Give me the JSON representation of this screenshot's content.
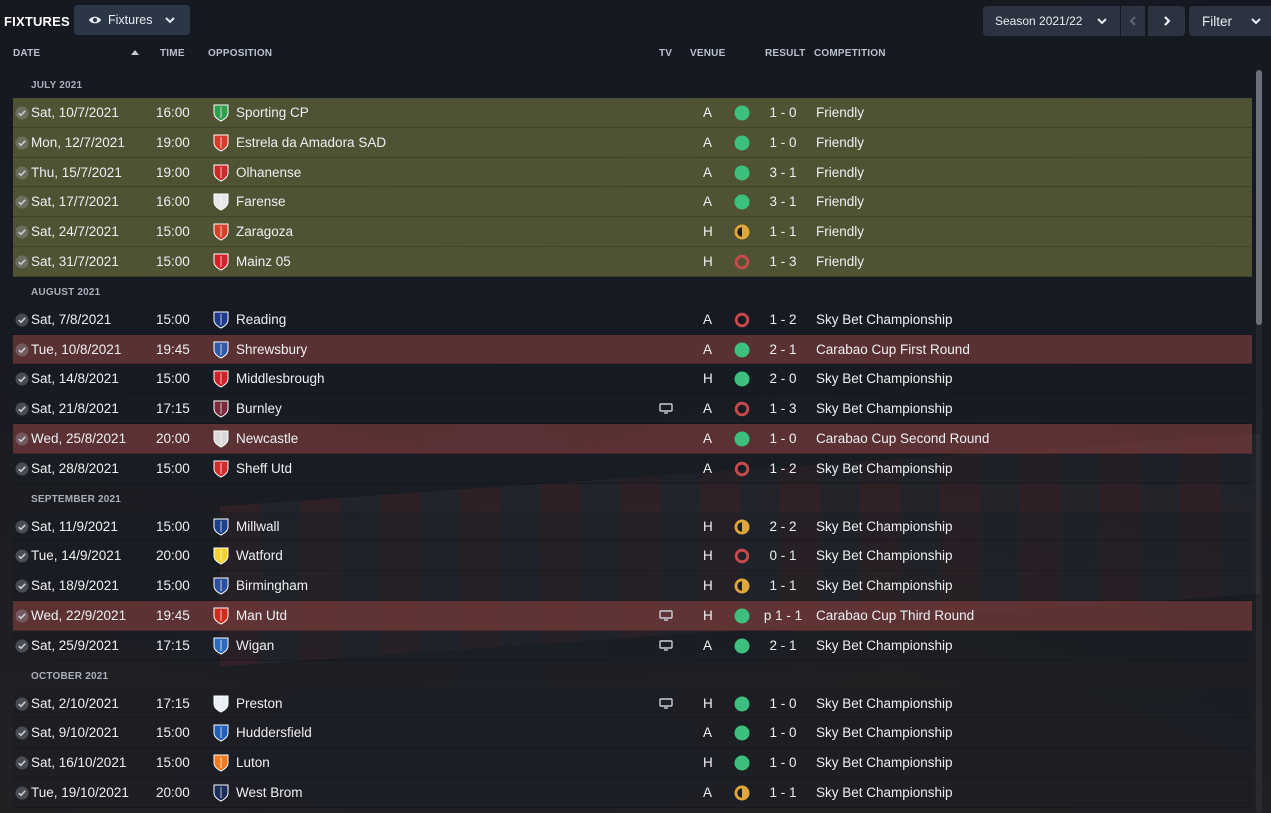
{
  "header": {
    "title": "FIXTURES",
    "view_label": "Fixtures",
    "season_label": "Season 2021/22",
    "filter_label": "Filter"
  },
  "columns": {
    "date": "DATE",
    "time": "TIME",
    "opposition": "OPPOSITION",
    "tv": "TV",
    "venue": "VENUE",
    "result": "RESULT",
    "competition": "COMPETITION"
  },
  "colors": {
    "win": "#3dbf7e",
    "draw": "#e0a83a",
    "loss": "#c94a4a",
    "friendly_row": "#66683c",
    "cup_row": "#743a3a"
  },
  "months": [
    {
      "label": "JULY 2021",
      "fixtures": [
        {
          "date": "Sat, 10/7/2021",
          "time": "16:00",
          "opponent": "Sporting CP",
          "crest": "sporting-crest-icon",
          "crest_color": "#2e9e4f",
          "tv": false,
          "venue": "A",
          "outcome": "win",
          "score": "1 - 0",
          "competition": "Friendly",
          "kind": "friendly"
        },
        {
          "date": "Mon, 12/7/2021",
          "time": "19:00",
          "opponent": "Estrela da Amadora SAD",
          "crest": "estrela-crest-icon",
          "crest_color": "#d93b2b",
          "tv": false,
          "venue": "A",
          "outcome": "win",
          "score": "1 - 0",
          "competition": "Friendly",
          "kind": "friendly"
        },
        {
          "date": "Thu, 15/7/2021",
          "time": "19:00",
          "opponent": "Olhanense",
          "crest": "olhanense-crest-icon",
          "crest_color": "#cc2a2a",
          "tv": false,
          "venue": "A",
          "outcome": "win",
          "score": "3 - 1",
          "competition": "Friendly",
          "kind": "friendly"
        },
        {
          "date": "Sat, 17/7/2021",
          "time": "16:00",
          "opponent": "Farense",
          "crest": "farense-crest-icon",
          "crest_color": "#e7e7e7",
          "tv": false,
          "venue": "A",
          "outcome": "win",
          "score": "3 - 1",
          "competition": "Friendly",
          "kind": "friendly"
        },
        {
          "date": "Sat, 24/7/2021",
          "time": "15:00",
          "opponent": "Zaragoza",
          "crest": "zaragoza-crest-icon",
          "crest_color": "#d8402a",
          "tv": false,
          "venue": "H",
          "outcome": "draw",
          "score": "1 - 1",
          "competition": "Friendly",
          "kind": "friendly"
        },
        {
          "date": "Sat, 31/7/2021",
          "time": "15:00",
          "opponent": "Mainz 05",
          "crest": "mainz-crest-icon",
          "crest_color": "#d6202a",
          "tv": false,
          "venue": "H",
          "outcome": "loss",
          "score": "1 - 3",
          "competition": "Friendly",
          "kind": "friendly"
        }
      ]
    },
    {
      "label": "AUGUST 2021",
      "fixtures": [
        {
          "date": "Sat, 7/8/2021",
          "time": "15:00",
          "opponent": "Reading",
          "crest": "reading-crest-icon",
          "crest_color": "#1f3a8a",
          "tv": false,
          "venue": "A",
          "outcome": "loss",
          "score": "1 - 2",
          "competition": "Sky Bet Championship",
          "kind": "league"
        },
        {
          "date": "Tue, 10/8/2021",
          "time": "19:45",
          "opponent": "Shrewsbury",
          "crest": "shrewsbury-crest-icon",
          "crest_color": "#2e5aa8",
          "tv": false,
          "venue": "A",
          "outcome": "win",
          "score": "2 - 1",
          "competition": "Carabao Cup First Round",
          "kind": "cup"
        },
        {
          "date": "Sat, 14/8/2021",
          "time": "15:00",
          "opponent": "Middlesbrough",
          "crest": "middlesbrough-crest-icon",
          "crest_color": "#d0202a",
          "tv": false,
          "venue": "H",
          "outcome": "win",
          "score": "2 - 0",
          "competition": "Sky Bet Championship",
          "kind": "league"
        },
        {
          "date": "Sat, 21/8/2021",
          "time": "17:15",
          "opponent": "Burnley",
          "crest": "burnley-crest-icon",
          "crest_color": "#7a2a3a",
          "tv": true,
          "venue": "A",
          "outcome": "loss",
          "score": "1 - 3",
          "competition": "Sky Bet Championship",
          "kind": "league"
        },
        {
          "date": "Wed, 25/8/2021",
          "time": "20:00",
          "opponent": "Newcastle",
          "crest": "newcastle-crest-icon",
          "crest_color": "#d8d8d8",
          "tv": false,
          "venue": "A",
          "outcome": "win",
          "score": "1 - 0",
          "competition": "Carabao Cup Second Round",
          "kind": "cup"
        },
        {
          "date": "Sat, 28/8/2021",
          "time": "15:00",
          "opponent": "Sheff Utd",
          "crest": "sheffutd-crest-icon",
          "crest_color": "#d32a2a",
          "tv": false,
          "venue": "A",
          "outcome": "loss",
          "score": "1 - 2",
          "competition": "Sky Bet Championship",
          "kind": "league"
        }
      ]
    },
    {
      "label": "SEPTEMBER 2021",
      "fixtures": [
        {
          "date": "Sat, 11/9/2021",
          "time": "15:00",
          "opponent": "Millwall",
          "crest": "millwall-crest-icon",
          "crest_color": "#1b3f8a",
          "tv": false,
          "venue": "H",
          "outcome": "draw",
          "score": "2 - 2",
          "competition": "Sky Bet Championship",
          "kind": "league"
        },
        {
          "date": "Tue, 14/9/2021",
          "time": "20:00",
          "opponent": "Watford",
          "crest": "watford-crest-icon",
          "crest_color": "#f5d22c",
          "tv": false,
          "venue": "H",
          "outcome": "loss",
          "score": "0 - 1",
          "competition": "Sky Bet Championship",
          "kind": "league"
        },
        {
          "date": "Sat, 18/9/2021",
          "time": "15:00",
          "opponent": "Birmingham",
          "crest": "birmingham-crest-icon",
          "crest_color": "#2a4ea0",
          "tv": false,
          "venue": "H",
          "outcome": "draw",
          "score": "1 - 1",
          "competition": "Sky Bet Championship",
          "kind": "league"
        },
        {
          "date": "Wed, 22/9/2021",
          "time": "19:45",
          "opponent": "Man Utd",
          "crest": "manutd-crest-icon",
          "crest_color": "#d32a1f",
          "tv": true,
          "venue": "H",
          "outcome": "win",
          "score": "p 1 - 1",
          "competition": "Carabao Cup Third Round",
          "kind": "cup"
        },
        {
          "date": "Sat, 25/9/2021",
          "time": "17:15",
          "opponent": "Wigan",
          "crest": "wigan-crest-icon",
          "crest_color": "#2a6bc0",
          "tv": true,
          "venue": "A",
          "outcome": "win",
          "score": "2 - 1",
          "competition": "Sky Bet Championship",
          "kind": "league"
        }
      ]
    },
    {
      "label": "OCTOBER 2021",
      "fixtures": [
        {
          "date": "Sat, 2/10/2021",
          "time": "17:15",
          "opponent": "Preston",
          "crest": "preston-crest-icon",
          "crest_color": "#e8eef5",
          "tv": true,
          "venue": "H",
          "outcome": "win",
          "score": "1 - 0",
          "competition": "Sky Bet Championship",
          "kind": "league"
        },
        {
          "date": "Sat, 9/10/2021",
          "time": "15:00",
          "opponent": "Huddersfield",
          "crest": "huddersfield-crest-icon",
          "crest_color": "#1f5fb8",
          "tv": false,
          "venue": "A",
          "outcome": "win",
          "score": "1 - 0",
          "competition": "Sky Bet Championship",
          "kind": "league"
        },
        {
          "date": "Sat, 16/10/2021",
          "time": "15:00",
          "opponent": "Luton",
          "crest": "luton-crest-icon",
          "crest_color": "#f07a1e",
          "tv": false,
          "venue": "H",
          "outcome": "win",
          "score": "1 - 0",
          "competition": "Sky Bet Championship",
          "kind": "league"
        },
        {
          "date": "Tue, 19/10/2021",
          "time": "20:00",
          "opponent": "West Brom",
          "crest": "westbrom-crest-icon",
          "crest_color": "#1c2e5a",
          "tv": false,
          "venue": "A",
          "outcome": "draw",
          "score": "1 - 1",
          "competition": "Sky Bet Championship",
          "kind": "league"
        }
      ]
    }
  ]
}
